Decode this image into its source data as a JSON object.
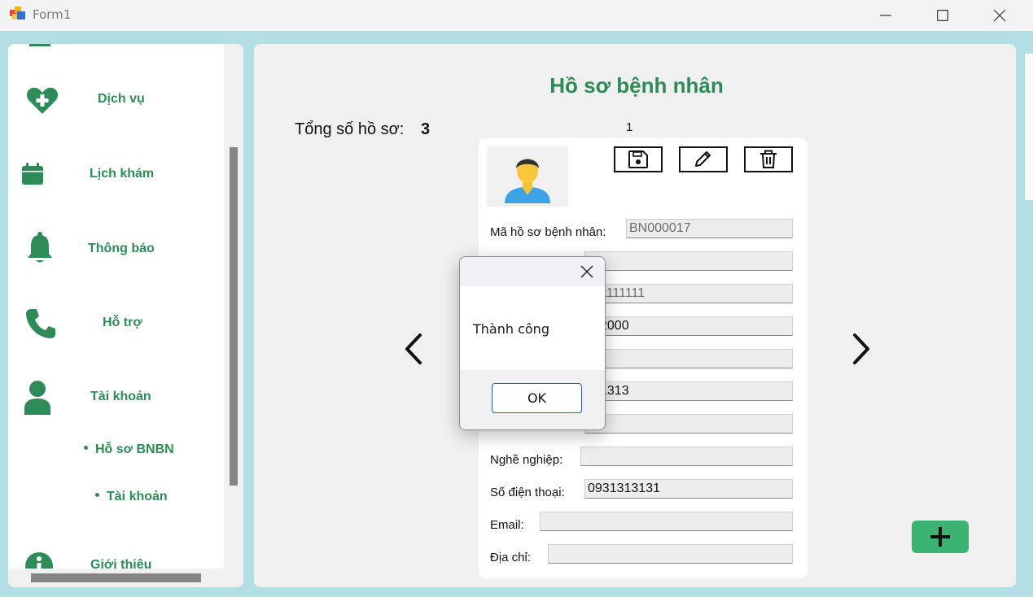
{
  "window": {
    "title": "Form1",
    "controls": [
      "minimize-icon",
      "maximize-icon",
      "close-icon"
    ]
  },
  "sidebar": {
    "items": [
      {
        "label": "Dịch vụ",
        "icon": "heart-plus-icon"
      },
      {
        "label": "Lịch khám",
        "icon": "calendar-icon"
      },
      {
        "label": "Thông báo",
        "icon": "bell-icon"
      },
      {
        "label": "Hỗ trợ",
        "icon": "phone-icon"
      },
      {
        "label": "Tài khoản",
        "icon": "user-icon"
      },
      {
        "label": "Giới thiệu",
        "icon": "info-icon"
      }
    ],
    "sub_items": [
      {
        "label": "Hỗ sơ BNBN"
      },
      {
        "label": "Tài khoản"
      }
    ]
  },
  "main": {
    "title": "Hồ sơ bệnh nhân",
    "total_label": "Tổng số hồ sơ:",
    "total_count": "3",
    "page_index": "1",
    "fields": [
      {
        "label": "Mã hồ sơ bệnh nhân:",
        "value": "BN000017",
        "readonly": true
      },
      {
        "label": "",
        "value": "",
        "readonly": false
      },
      {
        "label": "",
        "value": "1111111",
        "readonly": true
      },
      {
        "label": "",
        "value": "2000",
        "readonly": false
      },
      {
        "label": "",
        "value": "",
        "readonly": false
      },
      {
        "label": "",
        "value": "1313",
        "readonly": false
      },
      {
        "label": "",
        "value": "",
        "readonly": false
      },
      {
        "label": "Nghề nghiệp:",
        "value": "",
        "readonly": false
      },
      {
        "label": "Số điện thoại:",
        "value": "0931313131",
        "readonly": false
      },
      {
        "label": "Email:",
        "value": "",
        "readonly": false
      },
      {
        "label": "Địa chỉ:",
        "value": "",
        "readonly": false
      }
    ],
    "toolbar": [
      "save-icon",
      "pencil-icon",
      "trash-icon"
    ]
  },
  "dialog": {
    "message": "Thành công",
    "ok_label": "OK"
  },
  "colors": {
    "background": "#b2dfe3",
    "accent": "#2e8b57",
    "add_button": "#3cb371"
  }
}
